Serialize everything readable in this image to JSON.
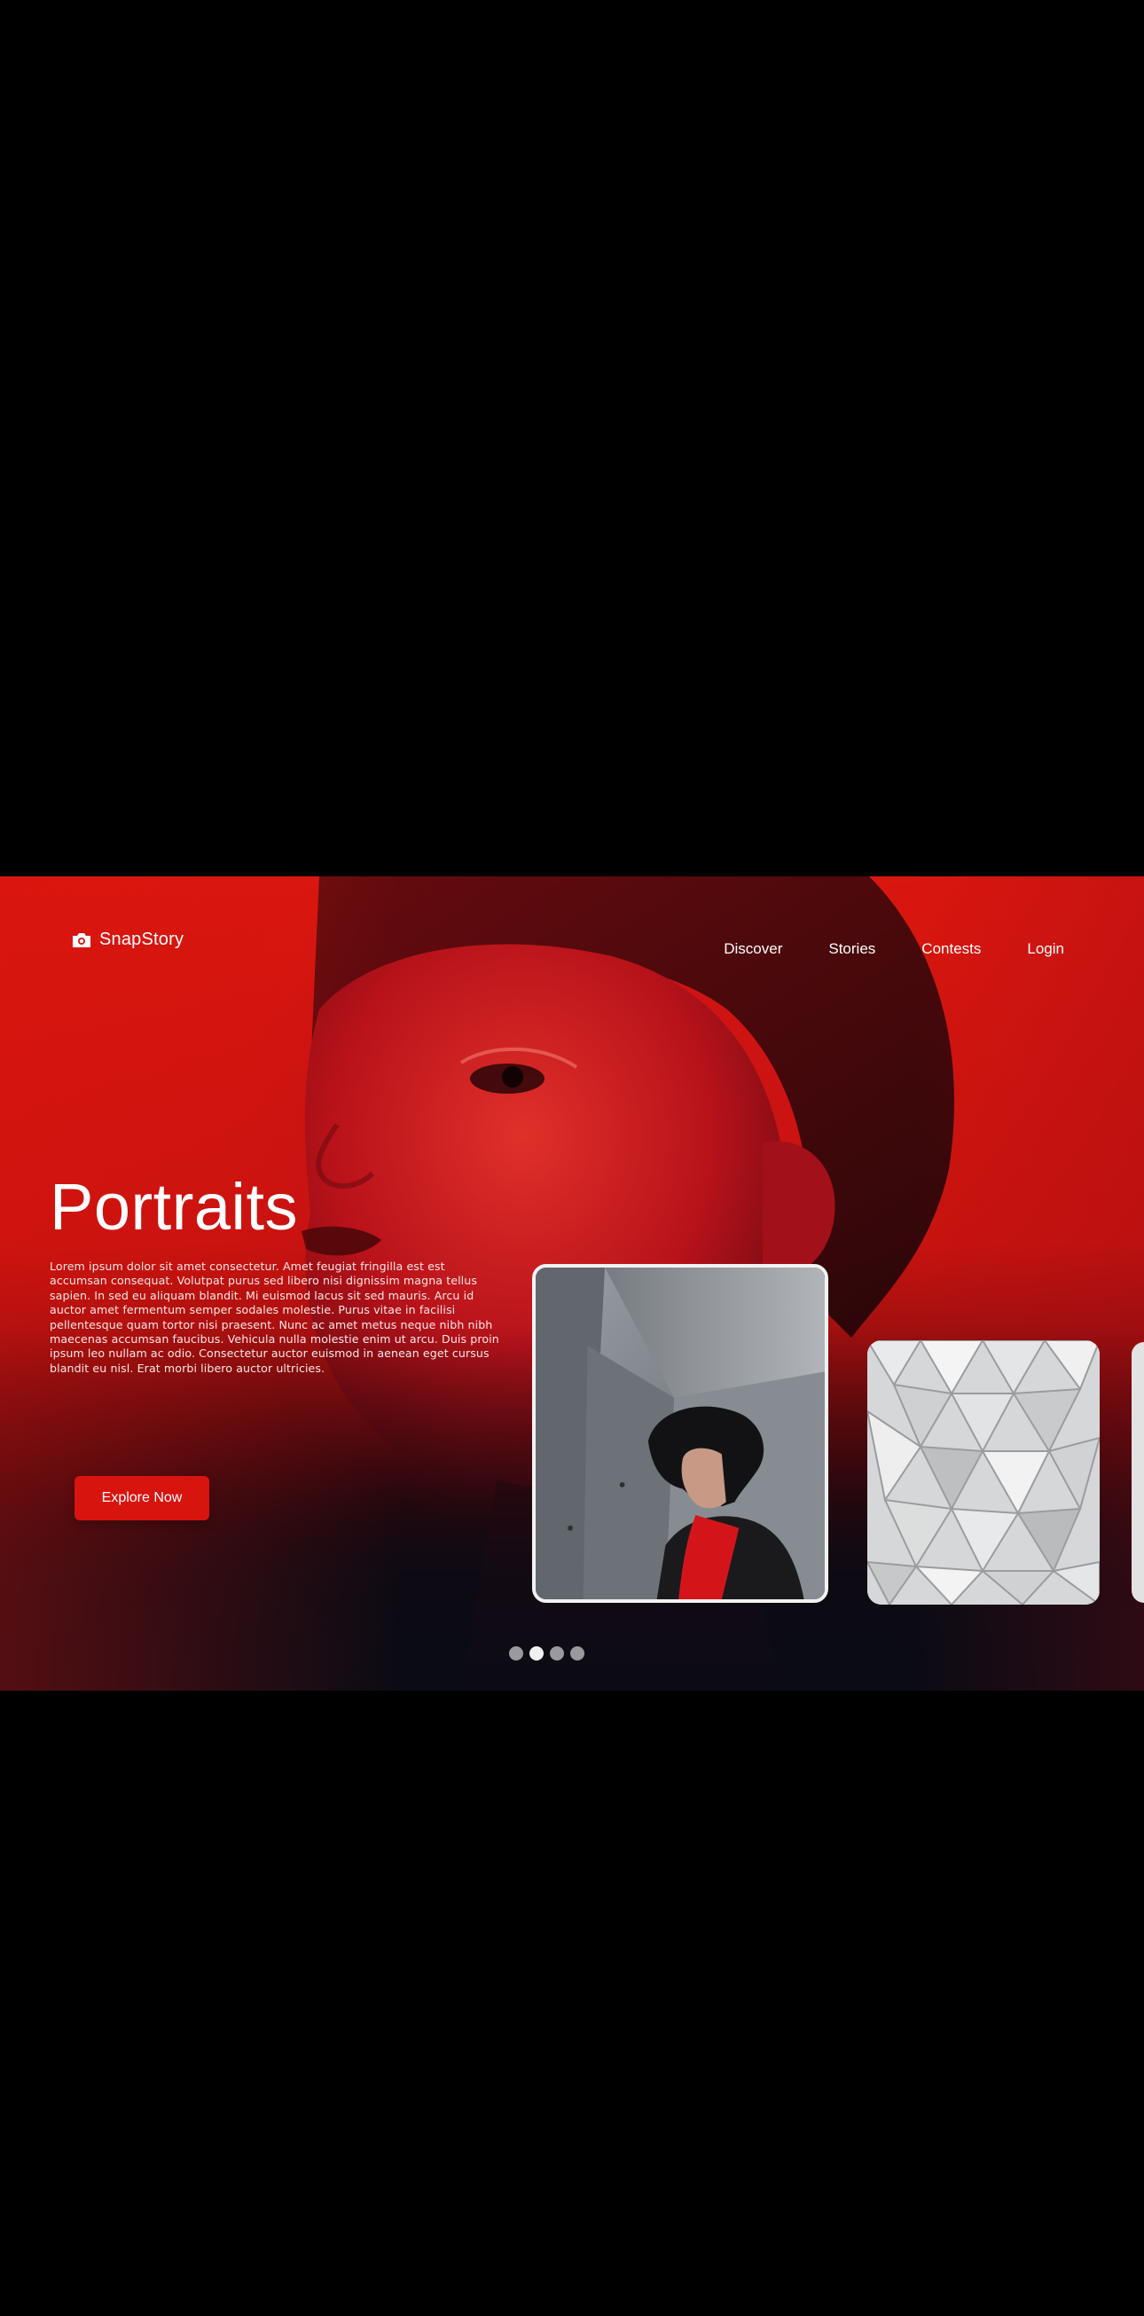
{
  "brand": {
    "name": "SnapStory",
    "icon": "camera-icon"
  },
  "nav": {
    "items": [
      {
        "label": "Discover"
      },
      {
        "label": "Stories"
      },
      {
        "label": "Contests"
      },
      {
        "label": "Login"
      }
    ]
  },
  "hero": {
    "title": "Portraits",
    "description": "Lorem ipsum dolor sit amet consectetur. Amet feugiat fringilla est est accumsan consequat. Volutpat purus sed libero nisi dignissim magna tellus sapien. In sed eu aliquam blandit. Mi euismod lacus sit sed mauris. Arcu id auctor amet fermentum semper sodales molestie. Purus vitae in facilisi pellentesque quam tortor nisi praesent. Nunc ac amet metus neque nibh nibh maecenas accumsan faucibus. Vehicula nulla molestie enim ut arcu. Duis proin ipsum leo nullam ac odio. Consectetur auctor euismod in aenean eget cursus blandit eu nisl. Erat morbi libero auctor ultricies.",
    "cta_label": "Explore Now"
  },
  "carousel": {
    "slide_count": 4,
    "active_index": 1
  },
  "colors": {
    "accent": "#d8140f",
    "background": "#000000",
    "hero_top": "#d9160f",
    "hero_bottom": "#0b0b14"
  }
}
